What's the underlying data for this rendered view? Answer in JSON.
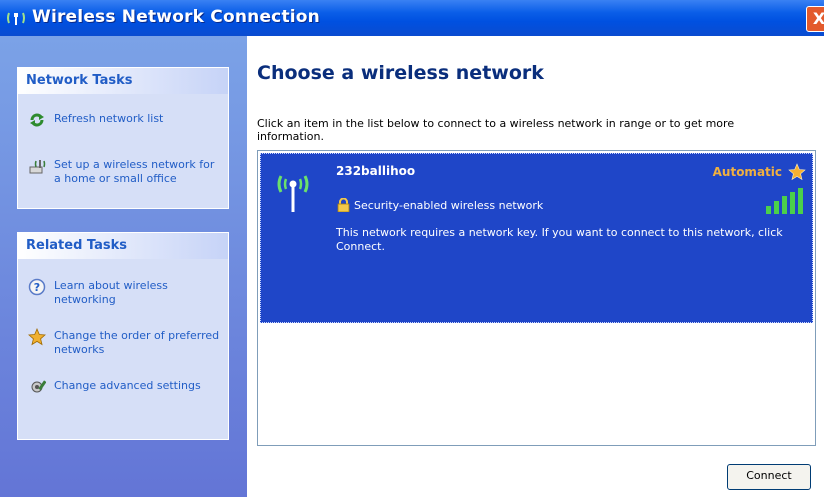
{
  "window": {
    "title": "Wireless Network Connection",
    "close_label": "X"
  },
  "sidebar": {
    "network_tasks": {
      "heading": "Network Tasks",
      "items": [
        {
          "label": "Refresh network list",
          "icon": "refresh-icon"
        },
        {
          "label": "Set up a wireless network for a home or small office",
          "icon": "setup-network-icon"
        }
      ]
    },
    "related_tasks": {
      "heading": "Related Tasks",
      "items": [
        {
          "label": "Learn about wireless networking",
          "icon": "help-icon"
        },
        {
          "label": "Change the order of preferred networks",
          "icon": "star-icon"
        },
        {
          "label": "Change advanced settings",
          "icon": "settings-icon"
        }
      ]
    }
  },
  "main": {
    "title": "Choose a wireless network",
    "description": "Click an item in the list below to connect to a wireless network in range or to get more information.",
    "networks": [
      {
        "name": "232ballihoo",
        "status": "Automatic",
        "security": "Security-enabled wireless network",
        "message": "This network requires a network key. If you want to connect to this network, click Connect."
      }
    ],
    "connect_label": "Connect"
  },
  "colors": {
    "titlebar": "#0a5ee8",
    "sidebar": "#6d8de0",
    "selection": "#1f46c8",
    "link": "#215dc6"
  }
}
